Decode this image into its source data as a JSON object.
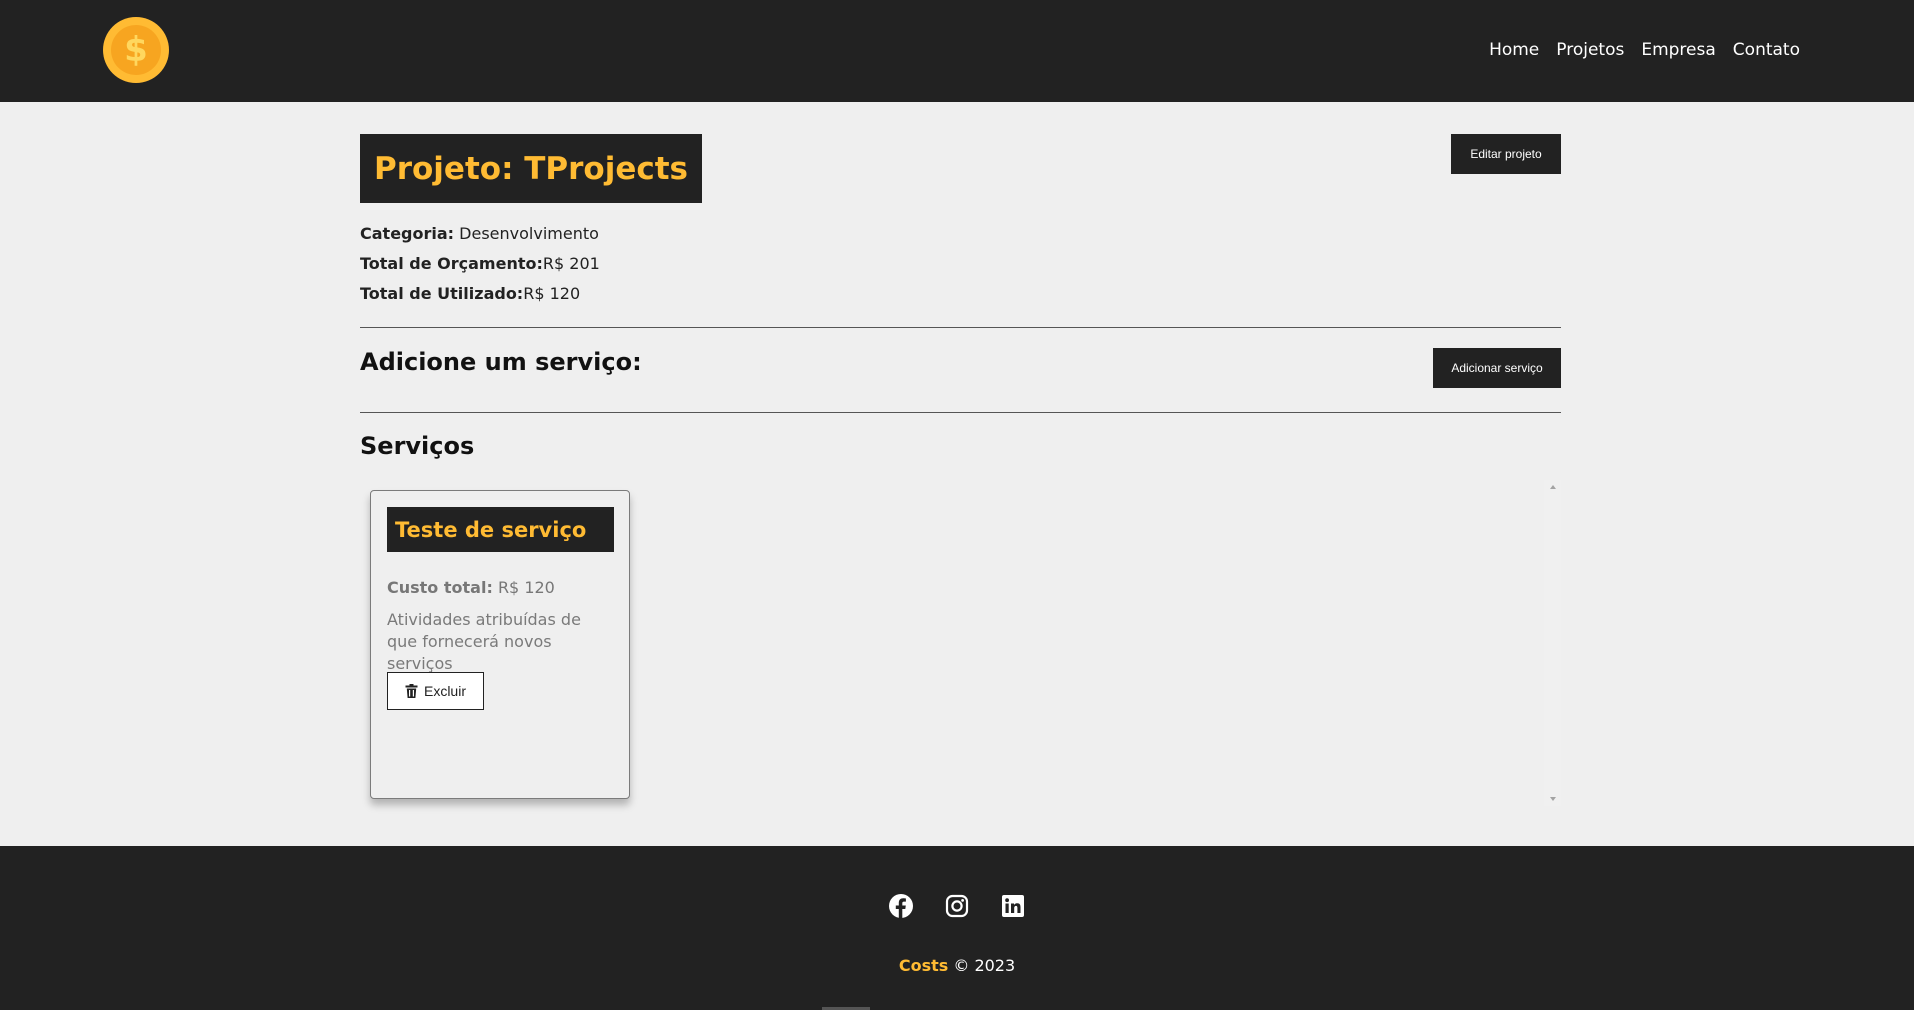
{
  "nav": {
    "links": [
      "Home",
      "Projetos",
      "Empresa",
      "Contato"
    ],
    "logo_icon": "coin-dollar-icon"
  },
  "project": {
    "title": "Projeto: TProjects",
    "edit_label": "Editar projeto",
    "category_label": "Categoria:",
    "category_value": "Desenvolvimento",
    "budget_label": "Total de Orçamento:",
    "budget_value": "R$ 201",
    "used_label": "Total de Utilizado:",
    "used_value": "R$ 120"
  },
  "add_service": {
    "title": "Adicione um serviço:",
    "button_label": "Adicionar serviço"
  },
  "services": {
    "title": "Serviços",
    "items": [
      {
        "name": "Teste de serviço",
        "cost_label": "Custo total:",
        "cost_value": "R$ 120",
        "description": "Atividades atribuídas de que fornecerá novos serviços",
        "delete_label": "Excluir"
      }
    ]
  },
  "footer": {
    "social_icons": [
      "facebook-icon",
      "instagram-icon",
      "linkedin-icon"
    ],
    "brand": "Costs",
    "copyright": "© 2023"
  },
  "colors": {
    "accent": "#ffbb33",
    "dark": "#222222",
    "background": "#efefef"
  }
}
